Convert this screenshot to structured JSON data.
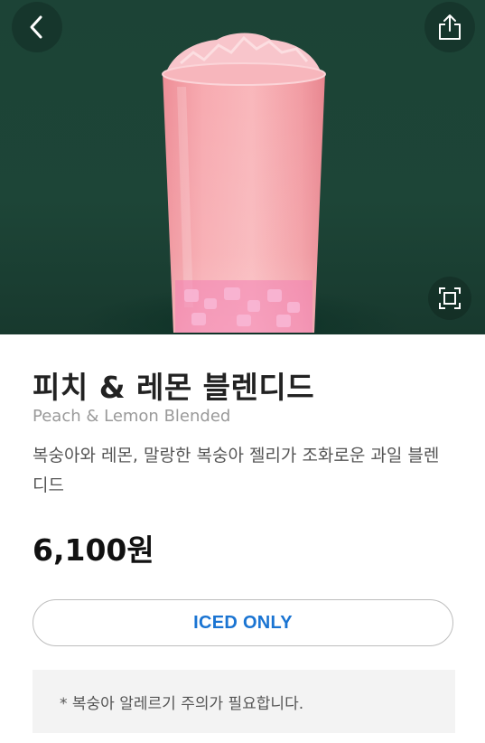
{
  "header": {
    "back_icon": "chevron-left-icon",
    "share_icon": "share-icon",
    "expand_icon": "expand-frame-icon"
  },
  "product": {
    "name_ko": "피치 & 레몬 블렌디드",
    "name_en": "Peach & Lemon Blended",
    "description": "복숭아와 레몬, 말랑한 복숭아 젤리가 조화로운 과일 블렌디드",
    "price": "6,100원",
    "temperature_option": "ICED ONLY",
    "allergy_notice": "* 복숭아 알레르기 주의가 필요합니다."
  },
  "colors": {
    "hero_background": "#1d4537",
    "drink_pink": "#f4a3a8",
    "accent_blue": "#1a74d2"
  }
}
